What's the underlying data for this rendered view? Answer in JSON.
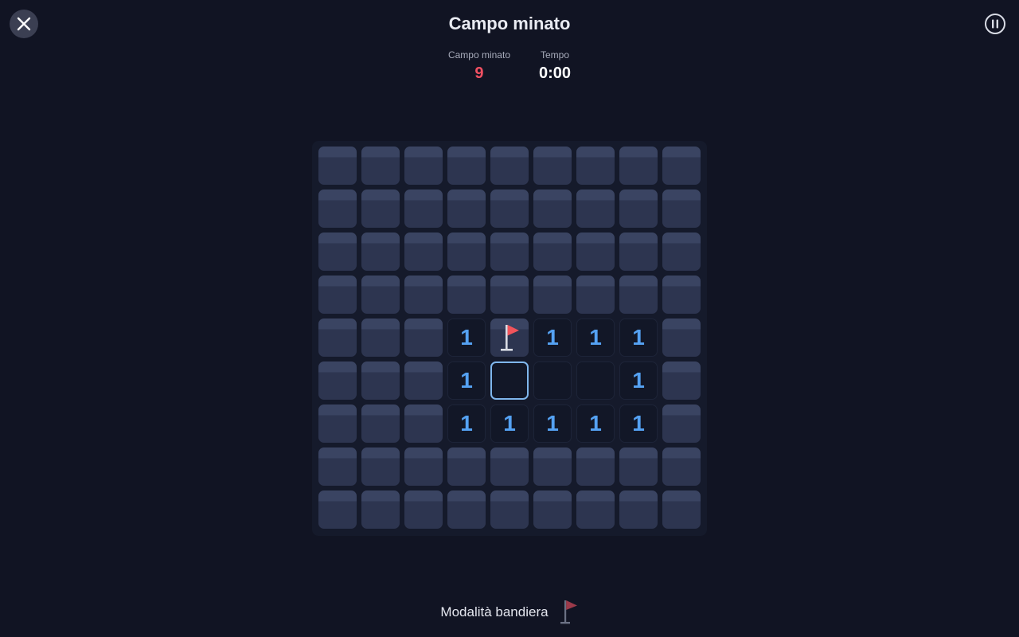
{
  "header": {
    "title": "Campo minato"
  },
  "stats": {
    "mines_label": "Campo minato",
    "mines_value": "9",
    "time_label": "Tempo",
    "time_value": "0:00"
  },
  "board": {
    "rows": 9,
    "cols": 9,
    "cells": [
      [
        "h",
        "h",
        "h",
        "h",
        "h",
        "h",
        "h",
        "h",
        "h"
      ],
      [
        "h",
        "h",
        "h",
        "h",
        "h",
        "h",
        "h",
        "h",
        "h"
      ],
      [
        "h",
        "h",
        "h",
        "h",
        "h",
        "h",
        "h",
        "h",
        "h"
      ],
      [
        "h",
        "h",
        "h",
        "h",
        "h",
        "h",
        "h",
        "h",
        "h"
      ],
      [
        "h",
        "h",
        "h",
        "1",
        "F",
        "1",
        "1",
        "1",
        "h"
      ],
      [
        "h",
        "h",
        "h",
        "1",
        "S",
        "0",
        "0",
        "1",
        "h"
      ],
      [
        "h",
        "h",
        "h",
        "1",
        "1",
        "1",
        "1",
        "1",
        "h"
      ],
      [
        "h",
        "h",
        "h",
        "h",
        "h",
        "h",
        "h",
        "h",
        "h"
      ],
      [
        "h",
        "h",
        "h",
        "h",
        "h",
        "h",
        "h",
        "h",
        "h"
      ]
    ]
  },
  "footer": {
    "flag_mode_label": "Modalità bandiera"
  },
  "icons": {
    "close": "close-icon",
    "pause": "pause-icon",
    "flag": "flag-icon"
  },
  "colors": {
    "background": "#111423",
    "mine_count": "#f05062",
    "number": "#55a2f3",
    "flag": "#f2545b",
    "flag_mode_flag": "#9c3a4a",
    "selection": "#7fb6ec"
  }
}
